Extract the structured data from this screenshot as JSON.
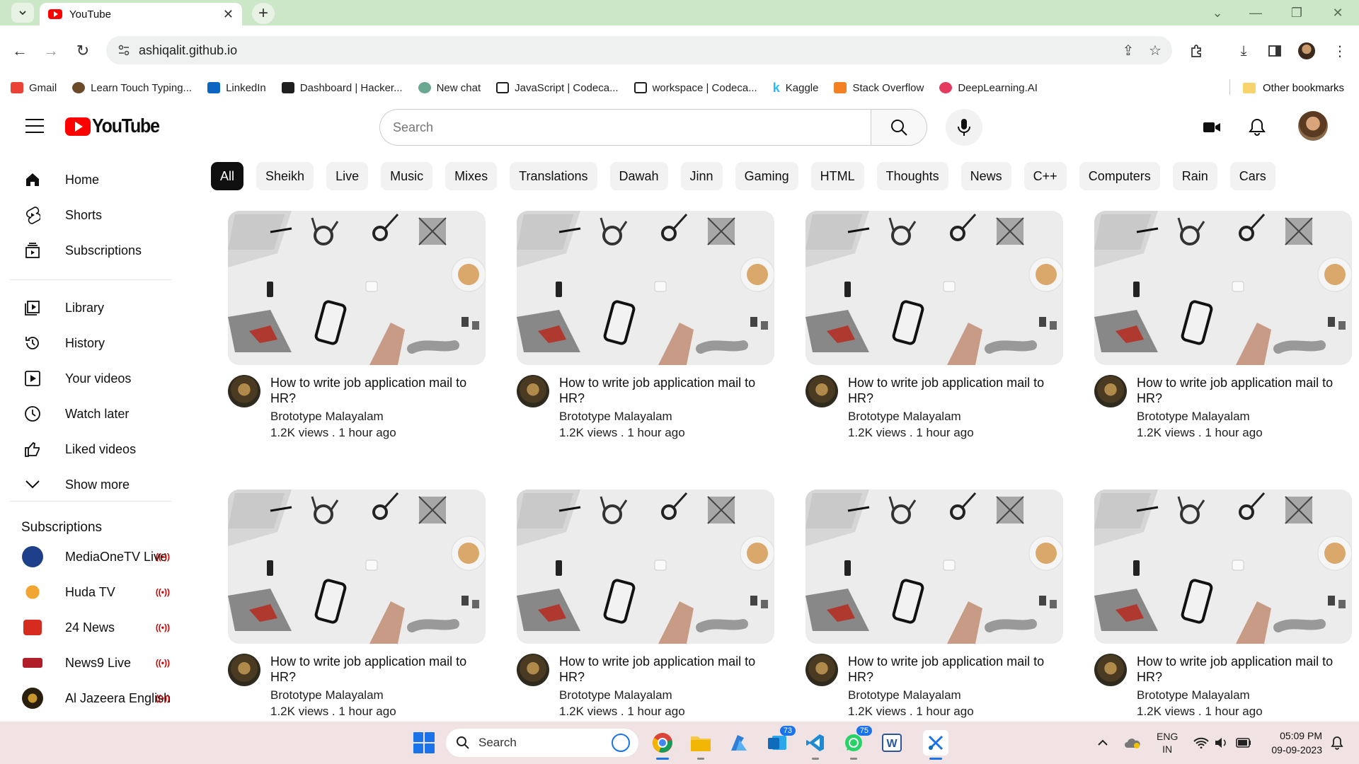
{
  "browser": {
    "tab_title": "YouTube",
    "url": "ashiqalit.github.io",
    "bookmarks": [
      {
        "label": "Gmail",
        "color": "#ea4335"
      },
      {
        "label": "Learn Touch Typing...",
        "color": "#6b4a2a"
      },
      {
        "label": "LinkedIn",
        "color": "#0a66c2"
      },
      {
        "label": "Dashboard | Hacker...",
        "color": "#1f1f1f"
      },
      {
        "label": "New chat",
        "color": "#6aa892"
      },
      {
        "label": "JavaScript | Codeca...",
        "color": "#1f1f1f"
      },
      {
        "label": "workspace | Codeca...",
        "color": "#1f1f1f"
      },
      {
        "label": "Kaggle",
        "color": "#20beff"
      },
      {
        "label": "Stack Overflow",
        "color": "#f48024"
      },
      {
        "label": "DeepLearning.AI",
        "color": "#e53960"
      }
    ],
    "other_bookmarks": "Other bookmarks"
  },
  "youtube": {
    "logo_text": "YouTube",
    "search_placeholder": "Search",
    "sidebar": {
      "primary": [
        "Home",
        "Shorts",
        "Subscriptions"
      ],
      "library": [
        "Library",
        "History",
        "Your videos",
        "Watch later",
        "Liked videos",
        "Show more"
      ],
      "subscriptions_heading": "Subscriptions",
      "subscriptions": [
        {
          "name": "MediaOneTV Live",
          "color": "#1e3f8a"
        },
        {
          "name": "Huda TV",
          "color": "#f3a531"
        },
        {
          "name": "24 News",
          "color": "#d62c1f"
        },
        {
          "name": "News9 Live",
          "color": "#b01e2a"
        },
        {
          "name": "Al Jazeera English",
          "color": "#2a1e0e"
        }
      ],
      "live_glyph": "((•))"
    },
    "chips": [
      "All",
      "Sheikh",
      "Live",
      "Music",
      "Mixes",
      "Translations",
      "Dawah",
      "Jinn",
      "Gaming",
      "HTML",
      "Thoughts",
      "News",
      "C++",
      "Computers",
      "Rain",
      "Cars"
    ],
    "videos": [
      {
        "title": "How to write job application mail to HR?",
        "channel": "Brototype Malayalam",
        "stats": "1.2K views  .  1 hour ago"
      },
      {
        "title": "How to write job application mail to HR?",
        "channel": "Brototype Malayalam",
        "stats": "1.2K views  .  1 hour ago"
      },
      {
        "title": "How to write job application mail to HR?",
        "channel": "Brototype Malayalam",
        "stats": "1.2K views  .  1 hour ago"
      },
      {
        "title": "How to write job application mail to HR?",
        "channel": "Brototype Malayalam",
        "stats": "1.2K views  .  1 hour ago"
      },
      {
        "title": "How to write job application mail to HR?",
        "channel": "Brototype Malayalam",
        "stats": "1.2K views  .  1 hour ago"
      },
      {
        "title": "How to write job application mail to HR?",
        "channel": "Brototype Malayalam",
        "stats": "1.2K views  .  1 hour ago"
      },
      {
        "title": "How to write job application mail to HR?",
        "channel": "Brototype Malayalam",
        "stats": "1.2K views  .  1 hour ago"
      },
      {
        "title": "How to write job application mail to HR?",
        "channel": "Brototype Malayalam",
        "stats": "1.2K views  .  1 hour ago"
      }
    ]
  },
  "taskbar": {
    "search_placeholder": "Search",
    "badges": {
      "outlook": "73",
      "whatsapp": "75"
    },
    "lang_top": "ENG",
    "lang_bottom": "IN",
    "time": "05:09 PM",
    "date": "09-09-2023"
  },
  "colors": {
    "youtube_red": "#ff0000",
    "titlebar": "#cbe7c7",
    "taskbar": "#f1e3e3"
  }
}
